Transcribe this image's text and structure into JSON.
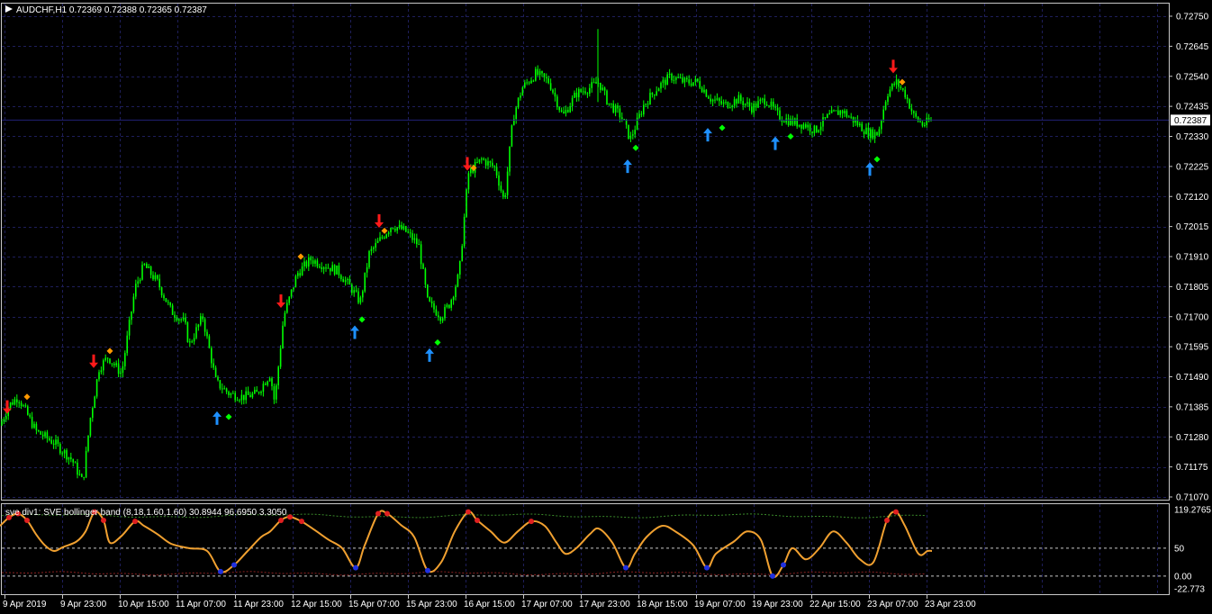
{
  "main_chart": {
    "symbol_header": "AUDCHF,H1  0.72369 0.72388 0.72365 0.72387",
    "current_price_label": "0.72387",
    "current_price": 0.72387,
    "price_ticks": [
      "0.72750",
      "0.72645",
      "0.72540",
      "0.72435",
      "0.72330",
      "0.72225",
      "0.72120",
      "0.72015",
      "0.71910",
      "0.71805",
      "0.71700",
      "0.71595",
      "0.71490",
      "0.71385",
      "0.71280",
      "0.71175",
      "0.71070"
    ],
    "y_range": [
      0.7106,
      0.72785
    ]
  },
  "indicator": {
    "header": "sve div1:  SVE bollinger band (8,18,1.60,1.60) 30.8944 96.6950 3.3050",
    "ticks": [
      "119.2765",
      "50",
      "0.00",
      "-22.773"
    ],
    "y_range": [
      -22.773,
      119.2765
    ]
  },
  "x_labels": [
    "9 Apr 2019",
    "9 Apr 23:00",
    "10 Apr 15:00",
    "11 Apr 07:00",
    "11 Apr 23:00",
    "12 Apr 15:00",
    "15 Apr 07:00",
    "15 Apr 23:00",
    "16 Apr 15:00",
    "17 Apr 07:00",
    "17 Apr 23:00",
    "18 Apr 15:00",
    "19 Apr 07:00",
    "19 Apr 23:00",
    "22 Apr 15:00",
    "23 Apr 07:00",
    "23 Apr 23:00"
  ],
  "colors": {
    "background": "#000000",
    "grid": "#1e1e5a",
    "candles": "#00ff00",
    "current_price_line": "#232377",
    "up_arrow": "#1e90ff",
    "down_arrow": "#ff1a1a",
    "orange_diamond": "#ff9900",
    "green_diamond": "#00ff00",
    "osc_line": "#f0a030",
    "osc_high": "#e02020",
    "osc_low": "#2030e0",
    "upper_band": "#3a8a2a",
    "lower_band": "#8a2020"
  },
  "chart_data": {
    "type": "candlestick",
    "title": "AUDCHF,H1",
    "x_axis_labels": [
      "9 Apr 2019",
      "9 Apr 23:00",
      "10 Apr 15:00",
      "11 Apr 07:00",
      "11 Apr 23:00",
      "12 Apr 15:00",
      "15 Apr 07:00",
      "15 Apr 23:00",
      "16 Apr 15:00",
      "17 Apr 07:00",
      "17 Apr 23:00",
      "18 Apr 15:00",
      "19 Apr 07:00",
      "19 Apr 23:00",
      "22 Apr 15:00",
      "23 Apr 07:00",
      "23 Apr 23:00"
    ],
    "y_range": [
      0.7107,
      0.7275
    ],
    "close_path_approx": [
      [
        0,
        0.7132
      ],
      [
        10,
        0.7139
      ],
      [
        20,
        0.7142
      ],
      [
        40,
        0.713
      ],
      [
        60,
        0.7126
      ],
      [
        80,
        0.712
      ],
      [
        92,
        0.7112
      ],
      [
        100,
        0.7134
      ],
      [
        110,
        0.7152
      ],
      [
        120,
        0.7156
      ],
      [
        135,
        0.715
      ],
      [
        150,
        0.718
      ],
      [
        160,
        0.7188
      ],
      [
        175,
        0.7182
      ],
      [
        190,
        0.7172
      ],
      [
        205,
        0.7168
      ],
      [
        210,
        0.716
      ],
      [
        225,
        0.717
      ],
      [
        240,
        0.7147
      ],
      [
        255,
        0.7143
      ],
      [
        270,
        0.7142
      ],
      [
        285,
        0.7143
      ],
      [
        300,
        0.715
      ],
      [
        305,
        0.714
      ],
      [
        315,
        0.717
      ],
      [
        330,
        0.7185
      ],
      [
        345,
        0.719
      ],
      [
        360,
        0.7188
      ],
      [
        375,
        0.7186
      ],
      [
        390,
        0.718
      ],
      [
        400,
        0.7175
      ],
      [
        410,
        0.7192
      ],
      [
        425,
        0.7198
      ],
      [
        435,
        0.7202
      ],
      [
        450,
        0.72
      ],
      [
        465,
        0.7195
      ],
      [
        475,
        0.7175
      ],
      [
        490,
        0.717
      ],
      [
        500,
        0.7175
      ],
      [
        510,
        0.7185
      ],
      [
        520,
        0.722
      ],
      [
        535,
        0.7225
      ],
      [
        550,
        0.7222
      ],
      [
        560,
        0.721
      ],
      [
        570,
        0.724
      ],
      [
        580,
        0.725
      ],
      [
        595,
        0.7255
      ],
      [
        610,
        0.7252
      ],
      [
        625,
        0.724
      ],
      [
        640,
        0.7248
      ],
      [
        655,
        0.725
      ],
      [
        665,
        0.7252
      ],
      [
        675,
        0.7245
      ],
      [
        690,
        0.724
      ],
      [
        700,
        0.7232
      ],
      [
        715,
        0.7244
      ],
      [
        730,
        0.725
      ],
      [
        745,
        0.7254
      ],
      [
        760,
        0.7252
      ],
      [
        775,
        0.7252
      ],
      [
        790,
        0.7246
      ],
      [
        805,
        0.7244
      ],
      [
        820,
        0.7246
      ],
      [
        835,
        0.7243
      ],
      [
        850,
        0.7246
      ],
      [
        865,
        0.724
      ],
      [
        880,
        0.7238
      ],
      [
        895,
        0.7237
      ],
      [
        905,
        0.7235
      ],
      [
        920,
        0.724
      ],
      [
        935,
        0.7242
      ],
      [
        950,
        0.7238
      ],
      [
        965,
        0.7234
      ],
      [
        975,
        0.7234
      ],
      [
        985,
        0.7248
      ],
      [
        995,
        0.7252
      ],
      [
        1005,
        0.7248
      ],
      [
        1015,
        0.724
      ],
      [
        1025,
        0.7237
      ],
      [
        1035,
        0.72387
      ]
    ],
    "signals": [
      {
        "type": "down",
        "x": 8,
        "price": 0.7137
      },
      {
        "type": "down",
        "x": 104,
        "price": 0.7153
      },
      {
        "type": "down",
        "x": 312,
        "price": 0.7174
      },
      {
        "type": "down",
        "x": 421,
        "price": 0.7202
      },
      {
        "type": "down",
        "x": 519,
        "price": 0.7222
      },
      {
        "type": "down",
        "x": 992,
        "price": 0.7256
      },
      {
        "type": "up",
        "x": 241,
        "price": 0.7136
      },
      {
        "type": "up",
        "x": 394,
        "price": 0.7166
      },
      {
        "type": "up",
        "x": 477,
        "price": 0.7158
      },
      {
        "type": "up",
        "x": 697,
        "price": 0.7224
      },
      {
        "type": "up",
        "x": 786,
        "price": 0.7235
      },
      {
        "type": "up",
        "x": 861,
        "price": 0.7232
      },
      {
        "type": "up",
        "x": 966,
        "price": 0.7223
      }
    ],
    "diamonds": [
      {
        "color": "orange",
        "x": 30,
        "price": 0.7142
      },
      {
        "color": "orange",
        "x": 122,
        "price": 0.7158
      },
      {
        "color": "orange",
        "x": 334,
        "price": 0.7191
      },
      {
        "color": "orange",
        "x": 427,
        "price": 0.72
      },
      {
        "color": "orange",
        "x": 526,
        "price": 0.7222
      },
      {
        "color": "orange",
        "x": 1002,
        "price": 0.7252
      },
      {
        "color": "green",
        "x": 254,
        "price": 0.7135
      },
      {
        "color": "green",
        "x": 402,
        "price": 0.7169
      },
      {
        "color": "green",
        "x": 486,
        "price": 0.7161
      },
      {
        "color": "green",
        "x": 706,
        "price": 0.7229
      },
      {
        "color": "green",
        "x": 802,
        "price": 0.7236
      },
      {
        "color": "green",
        "x": 878,
        "price": 0.7233
      },
      {
        "color": "green",
        "x": 974,
        "price": 0.7225
      }
    ],
    "oscillator_approx": [
      [
        0,
        90
      ],
      [
        10,
        105
      ],
      [
        20,
        112
      ],
      [
        30,
        100
      ],
      [
        40,
        75
      ],
      [
        50,
        55
      ],
      [
        60,
        45
      ],
      [
        70,
        52
      ],
      [
        85,
        62
      ],
      [
        95,
        80
      ],
      [
        105,
        115
      ],
      [
        115,
        100
      ],
      [
        122,
        60
      ],
      [
        135,
        72
      ],
      [
        150,
        98
      ],
      [
        160,
        90
      ],
      [
        175,
        75
      ],
      [
        190,
        58
      ],
      [
        210,
        50
      ],
      [
        230,
        45
      ],
      [
        245,
        8
      ],
      [
        260,
        20
      ],
      [
        275,
        45
      ],
      [
        290,
        70
      ],
      [
        300,
        80
      ],
      [
        312,
        100
      ],
      [
        322,
        106
      ],
      [
        335,
        98
      ],
      [
        350,
        82
      ],
      [
        365,
        65
      ],
      [
        380,
        50
      ],
      [
        395,
        15
      ],
      [
        405,
        55
      ],
      [
        420,
        112
      ],
      [
        430,
        112
      ],
      [
        445,
        92
      ],
      [
        460,
        70
      ],
      [
        475,
        10
      ],
      [
        490,
        25
      ],
      [
        505,
        80
      ],
      [
        520,
        115
      ],
      [
        530,
        100
      ],
      [
        545,
        80
      ],
      [
        560,
        60
      ],
      [
        575,
        80
      ],
      [
        590,
        98
      ],
      [
        605,
        90
      ],
      [
        618,
        60
      ],
      [
        628,
        40
      ],
      [
        640,
        50
      ],
      [
        655,
        75
      ],
      [
        665,
        85
      ],
      [
        680,
        60
      ],
      [
        695,
        15
      ],
      [
        705,
        40
      ],
      [
        718,
        70
      ],
      [
        735,
        90
      ],
      [
        750,
        80
      ],
      [
        770,
        55
      ],
      [
        785,
        15
      ],
      [
        795,
        40
      ],
      [
        815,
        62
      ],
      [
        830,
        80
      ],
      [
        845,
        65
      ],
      [
        858,
        0
      ],
      [
        870,
        20
      ],
      [
        880,
        50
      ],
      [
        895,
        30
      ],
      [
        910,
        50
      ],
      [
        925,
        80
      ],
      [
        940,
        60
      ],
      [
        955,
        30
      ],
      [
        970,
        25
      ],
      [
        985,
        100
      ],
      [
        995,
        115
      ],
      [
        1005,
        90
      ],
      [
        1020,
        40
      ],
      [
        1030,
        45
      ],
      [
        1035,
        45
      ]
    ],
    "upper_band_level": 108,
    "lower_band_level": 5
  }
}
